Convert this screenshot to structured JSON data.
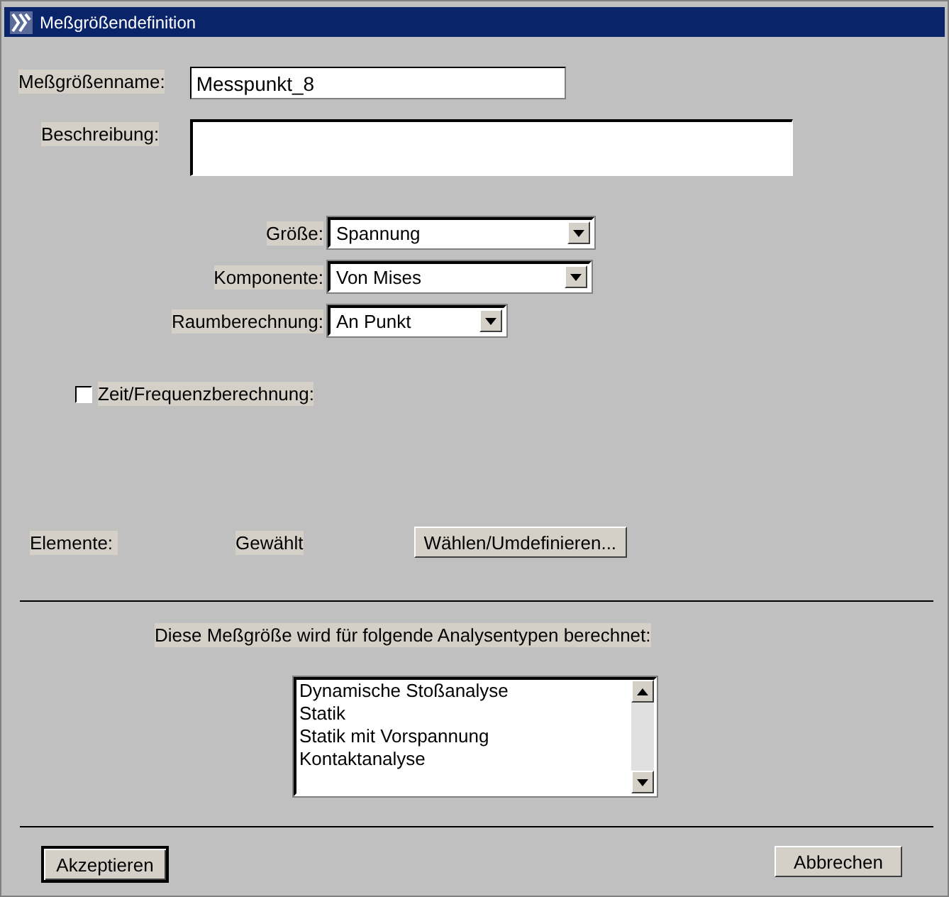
{
  "window": {
    "title": "Meßgrößendefinition"
  },
  "name_field": {
    "label": "Meßgrößenname:",
    "value": "Messpunkt_8"
  },
  "description_field": {
    "label": "Beschreibung:"
  },
  "dropdowns": [
    {
      "label": "Größe:",
      "value": "Spannung"
    },
    {
      "label": "Komponente:",
      "value": "Von Mises"
    },
    {
      "label": "Raumberechnung:",
      "value": "An Punkt"
    }
  ],
  "time_frequency": {
    "label": "Zeit/Frequenzberechnung:",
    "checked": false
  },
  "elements": {
    "label": "Elemente:",
    "status": "Gewählt",
    "button": "Wählen/Umdefinieren..."
  },
  "analysis": {
    "heading": "Diese Meßgröße wird für folgende Analysentypen berechnet:",
    "items": [
      "Dynamische Stoßanalyse",
      "Statik",
      "Statik mit Vorspannung",
      "Kontaktanalyse"
    ]
  },
  "buttons": [
    {
      "label": "Akzeptieren",
      "default": true
    },
    {
      "label": "Abbrechen",
      "default": false
    }
  ]
}
